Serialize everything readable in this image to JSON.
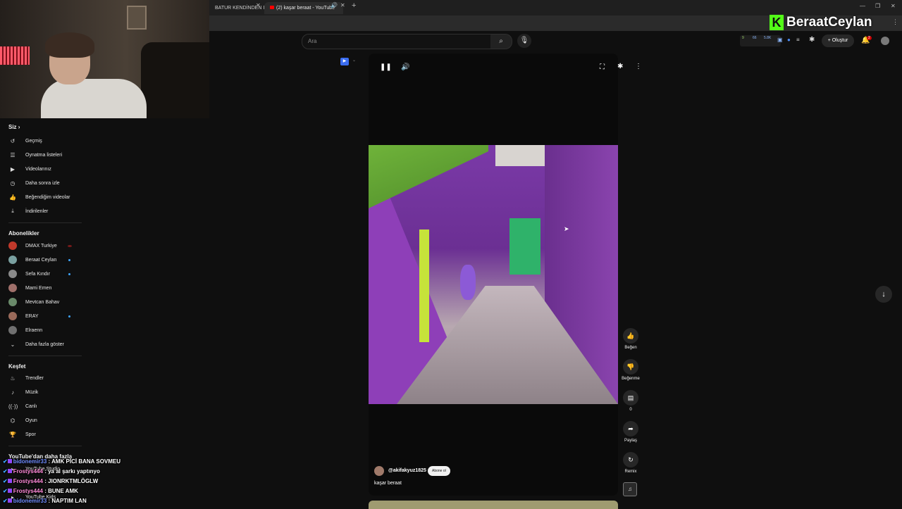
{
  "browser": {
    "tabs": [
      {
        "label": "BATUR KENDİNDEN Iİ"
      },
      {
        "label": "(2) kaşar beraat - YouTube"
      }
    ],
    "new_tab_icon": "plus-icon"
  },
  "brand": {
    "logo_letter": "K",
    "name": "BeraatCeylan",
    "color": "#53fc18"
  },
  "masthead": {
    "search_placeholder": "Ara",
    "extensions": [
      "9",
      "66",
      "5.8K"
    ],
    "create_label": "Oluştur",
    "notification_count": "2"
  },
  "sidebar": {
    "you_header": "Siz",
    "you_items": [
      {
        "label": "Geçmiş",
        "icon": "history-icon"
      },
      {
        "label": "Oynatma listeleri",
        "icon": "playlist-icon"
      },
      {
        "label": "Videolarınız",
        "icon": "video-icon"
      },
      {
        "label": "Daha sonra izle",
        "icon": "clock-icon"
      },
      {
        "label": "Beğendiğim videolar",
        "icon": "thumb-up-icon"
      },
      {
        "label": "İndirilenler",
        "icon": "download-icon"
      }
    ],
    "subs_header": "Abonelikler",
    "subscriptions": [
      {
        "label": "DMAX Turkiye",
        "color": "#c0392b",
        "dot": "red"
      },
      {
        "label": "Beraat Ceylan",
        "color": "#7aa0a0",
        "dot": "blue"
      },
      {
        "label": "Sefa Kındır",
        "color": "#8a8a8a",
        "dot": "blue"
      },
      {
        "label": "Mami Emen",
        "color": "#a0706a",
        "dot": ""
      },
      {
        "label": "Mevtcan Bahav",
        "color": "#6a8a6a",
        "dot": ""
      },
      {
        "label": "ERAY",
        "color": "#9a6a5a",
        "dot": "blue"
      },
      {
        "label": "Elraenn",
        "color": "#707070",
        "dot": ""
      }
    ],
    "show_more": "Daha fazla göster",
    "explore_header": "Keşfet",
    "explore_items": [
      {
        "label": "Trendler",
        "icon": "trending-icon"
      },
      {
        "label": "Müzik",
        "icon": "music-icon"
      },
      {
        "label": "Canlı",
        "icon": "live-icon"
      },
      {
        "label": "Oyun",
        "icon": "gaming-icon"
      },
      {
        "label": "Spor",
        "icon": "trophy-icon"
      }
    ],
    "more_header": "YouTube'dan daha fazla",
    "more_items": [
      "YouTube Studio",
      "YouTube Kids"
    ]
  },
  "chat": [
    {
      "user": "bidonemir33",
      "message": ": AMK PİCİ BANA SOVMEU"
    },
    {
      "user": "Frostys444",
      "message": ": ya al şarkı yaptınyo"
    },
    {
      "user": "Frostys444",
      "message": ": JIONRKTMLÖGLW"
    },
    {
      "user": "Frostys444",
      "message": ": BUNE AMK"
    },
    {
      "user": "bidonemir33",
      "message": ": NAPTIM LAN"
    }
  ],
  "short": {
    "channel": "@akifakyuz1825",
    "subscribe_label": "Abone ol",
    "title": "kaşar beraat"
  },
  "actions": {
    "like_label": "Beğen",
    "dislike_label": "Beğenme",
    "comment_count": "0",
    "share_label": "Paylaş",
    "remix_label": "Remix"
  }
}
